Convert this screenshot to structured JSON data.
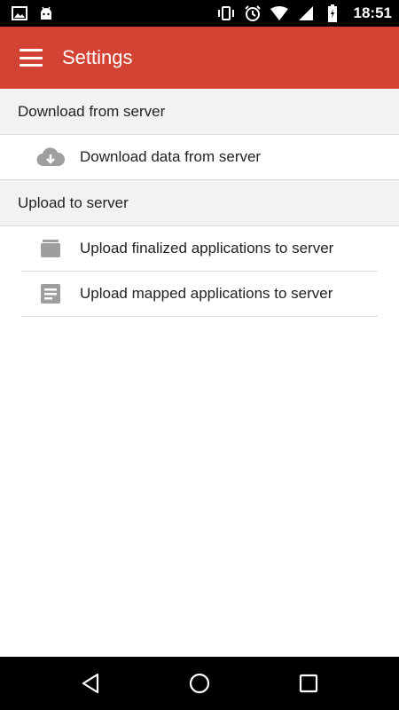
{
  "status_bar": {
    "time": "18:51",
    "left_icons": [
      "image-icon",
      "android-icon"
    ],
    "right_icons": [
      "vibrate-icon",
      "alarm-icon",
      "wifi-icon",
      "signal-icon",
      "battery-icon"
    ]
  },
  "app_bar": {
    "title": "Settings",
    "menu_icon": "hamburger-menu-icon",
    "color": "#d44233"
  },
  "sections": [
    {
      "header": "Download from server",
      "items": [
        {
          "label": "Download data from server",
          "icon": "cloud-download-icon"
        }
      ]
    },
    {
      "header": "Upload to server",
      "items": [
        {
          "label": "Upload finalized applications to server",
          "icon": "archive-box-icon"
        },
        {
          "label": "Upload mapped applications to server",
          "icon": "document-icon"
        }
      ]
    }
  ],
  "nav_bar": {
    "icons": [
      "back-icon",
      "home-icon",
      "recents-icon"
    ]
  }
}
